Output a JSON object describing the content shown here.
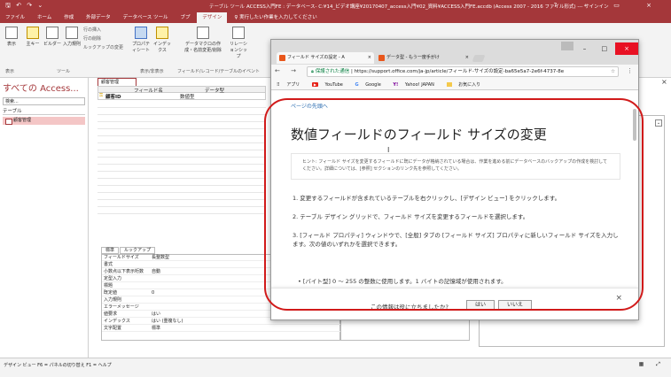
{
  "titlebar": {
    "quick_access": "🖫 ↶ ↷ ⌄",
    "context": "テーブル ツール",
    "title": "ACCESS入門FE : データベース- C:¥14_ビデオ講座¥20170407_access入門¥02_資料¥ACCESS入門FE.accdb (Access 2007 - 2016 ファイル形式) --- サインイン",
    "controls": "? – ▭ ×"
  },
  "tabs": [
    "ファイル",
    "ホーム",
    "作成",
    "外部データ",
    "データベース ツール",
    "ブプ",
    "デザイン",
    "♀ 実行したい作業を入力してください"
  ],
  "ribbon": {
    "buttons": [
      "表示",
      "主キー",
      "ビルダー",
      "入力規則",
      "プロパティシート",
      "インデックス",
      "データマクロの作成・名前変更/削除",
      "リレーションシップ"
    ],
    "small": [
      "行の挿入",
      "行の削除",
      "ルックアップの変更"
    ],
    "groups": [
      "表示",
      "ツール",
      "表示/非表示",
      "フィールド/レコード/テーブルのイベント"
    ]
  },
  "nav": {
    "header": "すべての Access...",
    "search_placeholder": "検索...",
    "section": "テーブル",
    "items": [
      "顧客管理"
    ]
  },
  "design": {
    "doc_tab": "顧客管理",
    "col_field": "フィールド名",
    "col_type": "データ型",
    "row_field": "顧客ID",
    "row_type": "数値型"
  },
  "props": {
    "tabs": [
      "標準",
      "ルックアップ"
    ],
    "rows": [
      {
        "k": "フィールドサイズ",
        "v": "長整数型"
      },
      {
        "k": "書式",
        "v": ""
      },
      {
        "k": "小数点以下表示桁数",
        "v": "自動"
      },
      {
        "k": "定型入力",
        "v": ""
      },
      {
        "k": "標題",
        "v": ""
      },
      {
        "k": "既定値",
        "v": "0"
      },
      {
        "k": "入力規則",
        "v": ""
      },
      {
        "k": "エラーメッセージ",
        "v": ""
      },
      {
        "k": "値要求",
        "v": "はい"
      },
      {
        "k": "インデックス",
        "v": "はい (重複なし)"
      },
      {
        "k": "文字配置",
        "v": "標準"
      }
    ]
  },
  "status": {
    "left": "デザイン ビュー F6 = パネルの切り替え F1 = ヘルプ"
  },
  "chrome": {
    "tabs": [
      "フィールド サイズの設定 - A",
      "データ型 - もう一度手がけ"
    ],
    "window_controls": [
      "–",
      "□",
      "×"
    ],
    "secure_label": "保護された通信",
    "url": "https://support.office.com/ja-jp/article/フィールド-サイズの設定-ba65e5a7-2e6f-4737-8e",
    "bookmarks": [
      "アプリ",
      "YouTube",
      "Google",
      "Yahoo! JAPAN",
      "お気に入り"
    ]
  },
  "article": {
    "to_top": "ページの先頭へ",
    "title": "数値フィールドのフィールド サイズの変更",
    "hint": "ヒント: フィールド サイズを変更するフィールドに既にデータが格納されている場合は、作業を進める前にデータベースのバックアップの作成を検討してください。詳細については、[参照] セクションのリンク先を参照してください。",
    "steps": [
      "1. 変更するフィールドが含まれているテーブルを右クリックし、[デザイン ビュー] をクリックします。",
      "2. テーブル デザイン グリッドで、フィールド サイズを変更するフィールドを選択します。",
      "3. [フィールド プロパティ] ウィンドウで、[全般] タブの [フィールド サイズ] プロパティに新しいフィールド サイズを入力します。次の値のいずれかを選択できます。"
    ],
    "bullet": "• [バイト型] 0 ～ 255 の整数に使用します。1 バイトの記憶域が使用されます。",
    "feedback_q": "この情報は役に立ちましたか?",
    "yes": "はい",
    "no": "いいえ"
  },
  "colors": {
    "access_red": "#a4373a",
    "highlight": "#d11a1a"
  }
}
